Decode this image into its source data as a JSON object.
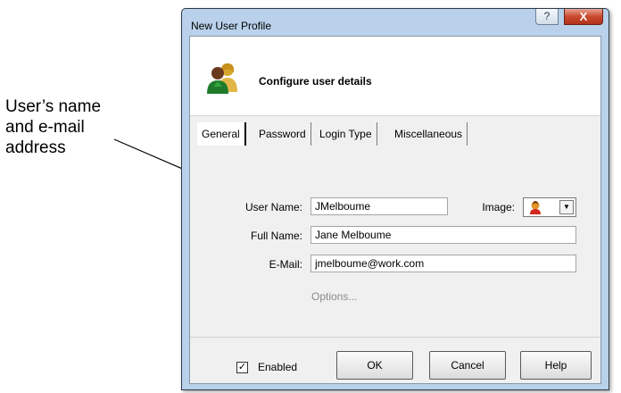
{
  "callout": {
    "lines": [
      "User’s name",
      "and e-mail",
      "address"
    ]
  },
  "window": {
    "title": "New User Profile",
    "help_glyph": "?",
    "close_glyph": "X"
  },
  "header": {
    "icon": "users-icon",
    "heading": "Configure user details"
  },
  "tabs": [
    {
      "label": "General",
      "active": true
    },
    {
      "label": "Password",
      "active": false
    },
    {
      "label": "Login Type",
      "active": false
    },
    {
      "label": "Miscellaneous",
      "active": false
    }
  ],
  "form": {
    "user_name_label": "User Name:",
    "user_name_value": "JMelboume",
    "image_label": "Image:",
    "image_icon": "user-avatar-icon",
    "full_name_label": "Full Name:",
    "full_name_value": "Jane Melboume",
    "email_label": "E-Mail:",
    "email_value": "jmelboume@work.com",
    "options_link": "Options..."
  },
  "footer": {
    "enabled_checked": true,
    "enabled_label": "Enabled",
    "ok_label": "OK",
    "cancel_label": "Cancel",
    "help_label": "Help"
  },
  "colors": {
    "frame": "#b9d1ea",
    "close_button": "#c94a2f",
    "client_bg": "#f0f0f0"
  }
}
